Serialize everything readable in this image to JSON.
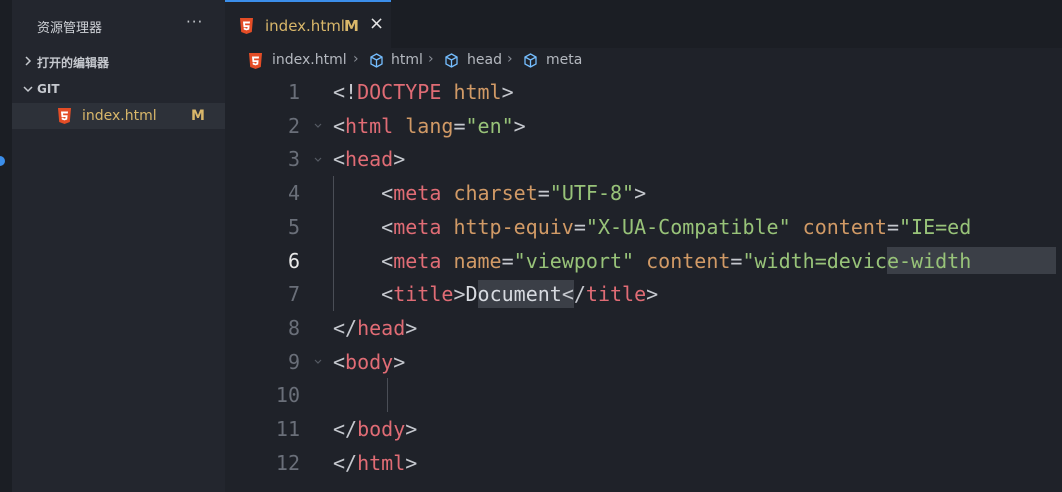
{
  "sidebar": {
    "title": "资源管理器",
    "more": "···",
    "sections": [
      {
        "label": "打开的编辑器"
      },
      {
        "label": "GIT"
      }
    ],
    "files": [
      {
        "name": "index.html",
        "badge": "M"
      }
    ]
  },
  "tab": {
    "name": "index.html",
    "badge": "M",
    "close": "×"
  },
  "breadcrumb": [
    "index.html",
    "html",
    "head",
    "meta"
  ],
  "editor": {
    "active_line": 6,
    "line_numbers": [
      "1",
      "2",
      "3",
      "4",
      "5",
      "6",
      "7",
      "8",
      "9",
      "10",
      "11",
      "12"
    ],
    "lines": [
      {
        "text": "<!DOCTYPE html>"
      },
      {
        "text": "<html lang=\"en\">"
      },
      {
        "text": "<head>"
      },
      {
        "text": "    <meta charset=\"UTF-8\">"
      },
      {
        "text": "    <meta http-equiv=\"X-UA-Compatible\" content=\"IE=ed"
      },
      {
        "text": "    <meta name=\"viewport\" content=\"width=device-width"
      },
      {
        "text": "    <title>Document</title>"
      },
      {
        "text": "</head>"
      },
      {
        "text": "<body>"
      },
      {
        "text": ""
      },
      {
        "text": "</body>"
      },
      {
        "text": "</html>"
      }
    ]
  },
  "colors": {
    "tag": "#e06c75",
    "attribute": "#d19a66",
    "string": "#98c379",
    "punctuation": "#c5c8ce",
    "modified": "#d9b76a",
    "accent": "#3b8eea"
  },
  "icons": {
    "file": "html5-icon",
    "breadcrumb_symbol": "cube-icon",
    "chevron_right": "chevron-right-icon",
    "chevron_down": "chevron-down-icon"
  }
}
